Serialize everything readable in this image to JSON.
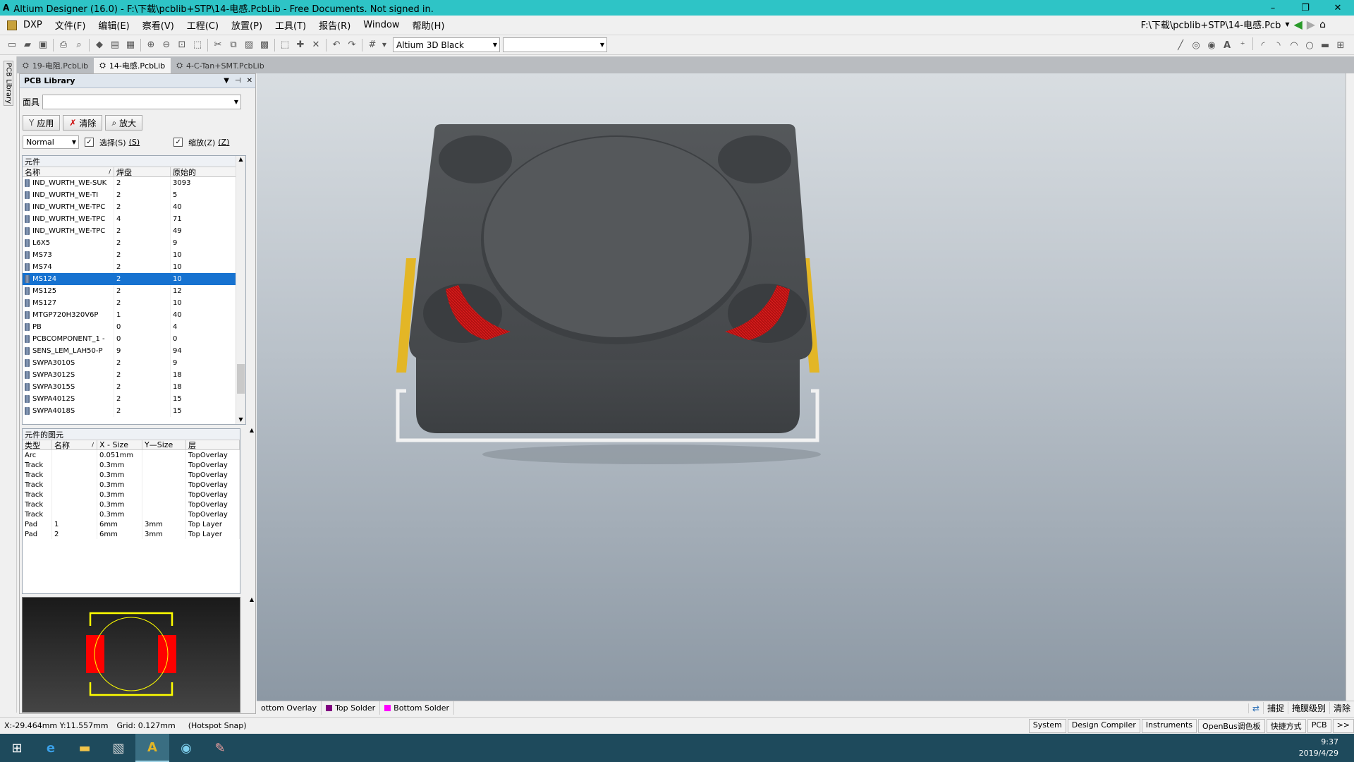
{
  "window": {
    "title": "Altium Designer (16.0) - F:\\下载\\pcblib+STP\\14-电感.PcbLib - Free Documents. Not signed in.",
    "minimize": "–",
    "restore": "❐",
    "close": "✕"
  },
  "menu": {
    "items": [
      "DXP",
      "文件(F)",
      "编辑(E)",
      "察看(V)",
      "工程(C)",
      "放置(P)",
      "工具(T)",
      "报告(R)",
      "Window",
      "帮助(H)"
    ],
    "path": "F:\\下载\\pcblib+STP\\14-电感.Pcb"
  },
  "toolbar": {
    "view_config": "Altium 3D Black",
    "second_combo": ""
  },
  "doc_tabs": [
    "19-电阻.PcbLib",
    "14-电感.PcbLib",
    "4-C-Tan+SMT.PcbLib"
  ],
  "side_strip": {
    "label": "PCB Library"
  },
  "panel": {
    "title": "PCB Library",
    "mask_label": "面具",
    "mask_value": "",
    "apply": "应用",
    "clear": "清除",
    "zoom": "放大",
    "mode": "Normal",
    "select_label": "选择(S)",
    "select_key": "(S)",
    "zoom_chk_label": "缩放(Z)",
    "zoom_chk_key": "(Z)",
    "components": {
      "title": "元件",
      "headers": [
        "名称",
        "焊盘",
        "原始的"
      ],
      "rows": [
        [
          "IND_WURTH_WE-SUK",
          "2",
          "3093"
        ],
        [
          "IND_WURTH_WE-TI",
          "2",
          "5"
        ],
        [
          "IND_WURTH_WE-TPC",
          "2",
          "40"
        ],
        [
          "IND_WURTH_WE-TPC",
          "4",
          "71"
        ],
        [
          "IND_WURTH_WE-TPC",
          "2",
          "49"
        ],
        [
          "L6X5",
          "2",
          "9"
        ],
        [
          "MS73",
          "2",
          "10"
        ],
        [
          "MS74",
          "2",
          "10"
        ],
        [
          "MS124",
          "2",
          "10"
        ],
        [
          "MS125",
          "2",
          "12"
        ],
        [
          "MS127",
          "2",
          "10"
        ],
        [
          "MTGP720H320V6P",
          "1",
          "40"
        ],
        [
          "PB",
          "0",
          "4"
        ],
        [
          "PCBCOMPONENT_1 -",
          "0",
          "0"
        ],
        [
          "SENS_LEM_LAH50-P",
          "9",
          "94"
        ],
        [
          "SWPA3010S",
          "2",
          "9"
        ],
        [
          "SWPA3012S",
          "2",
          "18"
        ],
        [
          "SWPA3015S",
          "2",
          "18"
        ],
        [
          "SWPA4012S",
          "2",
          "15"
        ],
        [
          "SWPA4018S",
          "2",
          "15"
        ]
      ],
      "selected_index": 8
    },
    "primitives": {
      "title": "元件的图元",
      "headers": [
        "类型",
        "名称",
        "X - Size",
        "Y—Size",
        "层"
      ],
      "rows": [
        [
          "Arc",
          "",
          "0.051mm",
          "",
          "TopOverlay"
        ],
        [
          "Track",
          "",
          "0.3mm",
          "",
          "TopOverlay"
        ],
        [
          "Track",
          "",
          "0.3mm",
          "",
          "TopOverlay"
        ],
        [
          "Track",
          "",
          "0.3mm",
          "",
          "TopOverlay"
        ],
        [
          "Track",
          "",
          "0.3mm",
          "",
          "TopOverlay"
        ],
        [
          "Track",
          "",
          "0.3mm",
          "",
          "TopOverlay"
        ],
        [
          "Track",
          "",
          "0.3mm",
          "",
          "TopOverlay"
        ],
        [
          "Pad",
          "1",
          "6mm",
          "3mm",
          "Top Layer"
        ],
        [
          "Pad",
          "2",
          "6mm",
          "3mm",
          "Top Layer"
        ]
      ]
    }
  },
  "layers": {
    "tabs": [
      {
        "name": "ottom Overlay",
        "color": ""
      },
      {
        "name": "Top Solder",
        "color": "#800080"
      },
      {
        "name": "Bottom Solder",
        "color": "#ff00ff"
      }
    ],
    "right": [
      "捕捉",
      "掩膜级别",
      "清除"
    ]
  },
  "status": {
    "coords": "X:-29.464mm Y:11.557mm",
    "grid": "Grid: 0.127mm",
    "snap": "(Hotspot Snap)",
    "right": [
      "System",
      "Design Compiler",
      "Instruments",
      "OpenBus调色板",
      "快捷方式",
      "PCB",
      ">>"
    ]
  },
  "clock": {
    "time": "9:37",
    "date": "2019/4/29"
  },
  "colors": {
    "titlebar": "#2ec4c6",
    "selection": "#1672d0",
    "pad": "#ff0000",
    "overlay": "#ffff00",
    "body3d": "#505356",
    "terminal": "#e8b923"
  }
}
